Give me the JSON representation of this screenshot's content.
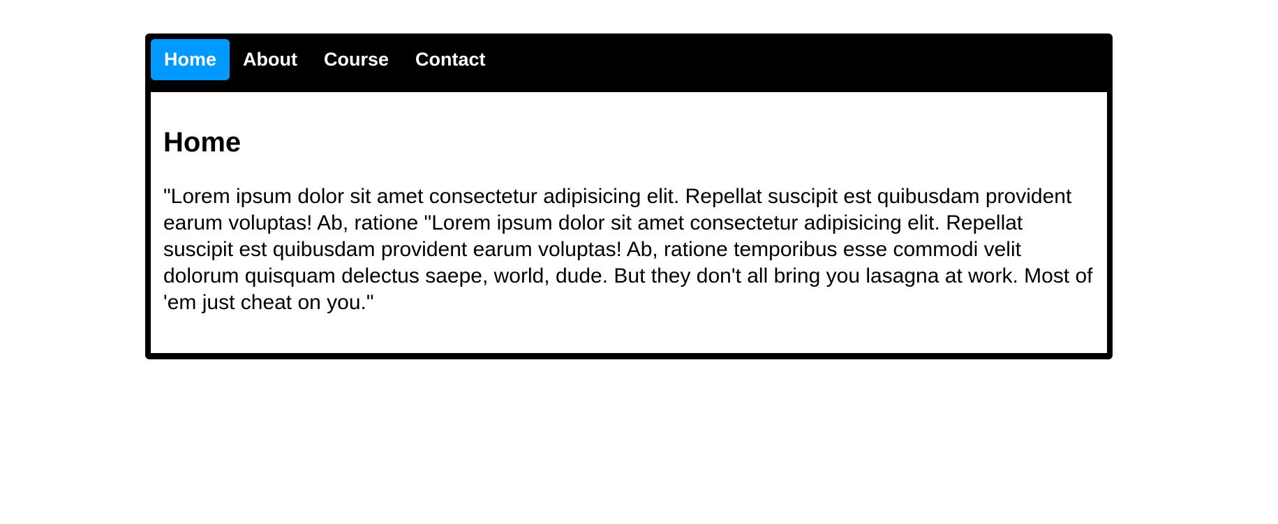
{
  "nav": {
    "items": [
      {
        "label": "Home",
        "active": true
      },
      {
        "label": "About",
        "active": false
      },
      {
        "label": "Course",
        "active": false
      },
      {
        "label": "Contact",
        "active": false
      }
    ]
  },
  "main": {
    "heading": "Home",
    "body": "\"Lorem ipsum dolor sit amet consectetur adipisicing elit. Repellat suscipit est quibusdam provident earum voluptas! Ab, ratione \"Lorem ipsum dolor sit amet consectetur adipisicing elit. Repellat suscipit est quibusdam provident earum voluptas! Ab, ratione temporibus esse commodi velit dolorum quisquam delectus saepe, world, dude. But they don't all bring you lasagna at work. Most of 'em just cheat on you.\""
  },
  "colors": {
    "frame": "#000000",
    "active_tab": "#0099ff",
    "nav_text": "#ffffff",
    "content_bg": "#ffffff"
  }
}
